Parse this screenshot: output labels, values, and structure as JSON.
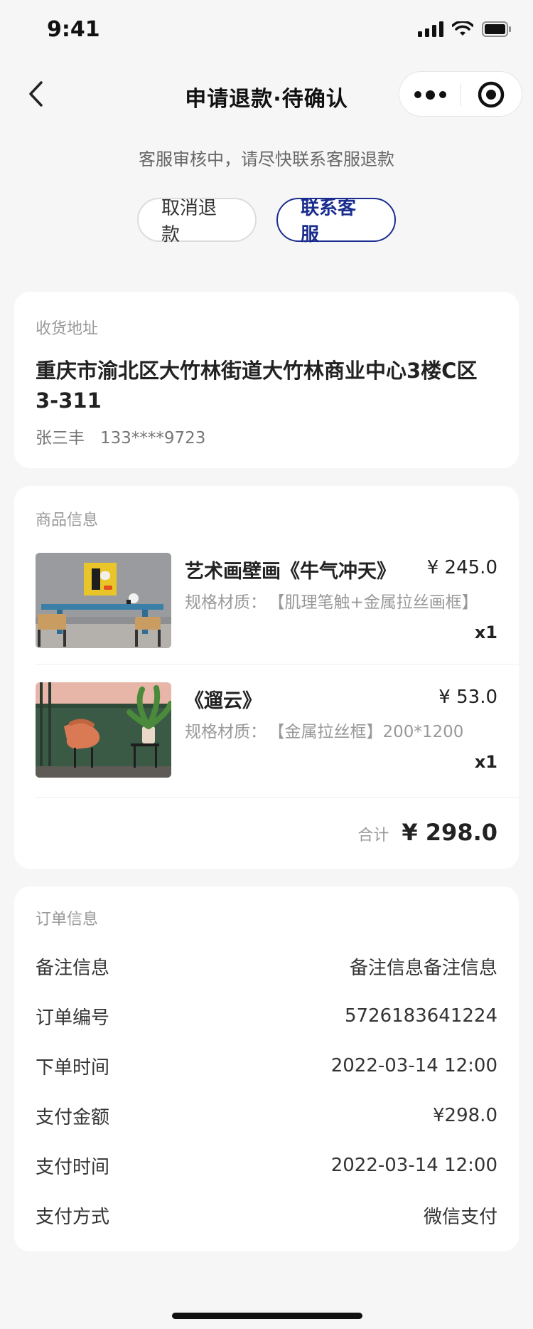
{
  "status_bar": {
    "time": "9:41"
  },
  "nav": {
    "title": "申请退款·待确认"
  },
  "refund": {
    "status_message": "客服审核中，请尽快联系客服退款",
    "cancel_label": "取消退款",
    "contact_label": "联系客服"
  },
  "address": {
    "section_label": "收货地址",
    "line": "重庆市渝北区大竹林街道大竹林商业中心3楼C区3-311",
    "name": "张三丰",
    "phone": "133****9723"
  },
  "goods": {
    "section_label": "商品信息",
    "items": [
      {
        "name": "艺术画壁画《牛气冲天》",
        "price": "¥ 245.0",
        "spec_key": "规格材质：",
        "spec_value": "【肌理笔触+金属拉丝画框】",
        "qty": "x1"
      },
      {
        "name": "《遛云》",
        "price": "¥ 53.0",
        "spec_key": "规格材质：",
        "spec_value": "【金属拉丝框】200*1200",
        "qty": "x1"
      }
    ],
    "total_label": "合计",
    "total_value": "¥ 298.0"
  },
  "order": {
    "section_label": "订单信息",
    "rows": [
      {
        "label": "备注信息",
        "value": "备注信息备注信息"
      },
      {
        "label": "订单编号",
        "value": "5726183641224"
      },
      {
        "label": "下单时间",
        "value": "2022-03-14 12:00"
      },
      {
        "label": "支付金额",
        "value": "¥298.0"
      },
      {
        "label": "支付时间",
        "value": "2022-03-14 12:00"
      },
      {
        "label": "支付方式",
        "value": "微信支付"
      }
    ]
  },
  "colors": {
    "accent": "#1a2d8e",
    "background": "#f6f6f7",
    "card": "#ffffff"
  }
}
